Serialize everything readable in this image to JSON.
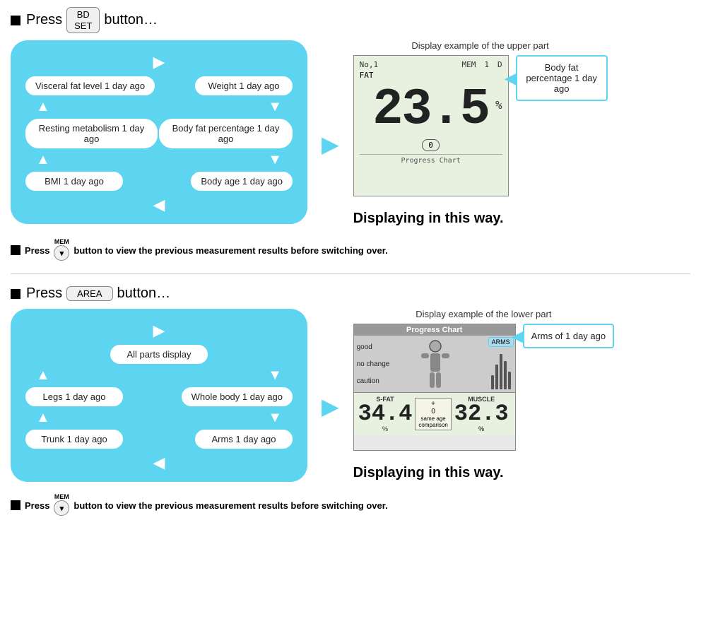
{
  "section1": {
    "header": "Press",
    "button_top": "BD",
    "button_bottom": "SET",
    "button_suffix": "button…",
    "display_label": "Display example of the upper part",
    "lcd": {
      "no": "No,1",
      "mem": "MEM",
      "one": "1",
      "d": "D",
      "fat": "FAT",
      "big_number": "23.5",
      "percent": "%",
      "zero": "0",
      "progress_chart": "Progress Chart"
    },
    "callout": "Body fat percentage 1 day ago",
    "items_left": [
      "Visceral fat level 1 day ago",
      "Resting metabolism 1 day ago",
      "BMI 1 day ago"
    ],
    "items_right": [
      "Weight 1 day ago",
      "Body fat percentage 1 day ago",
      "Body age 1 day ago"
    ],
    "displaying": "Displaying in this way.",
    "note": "Press",
    "mem_label": "MEM",
    "mem_arrow": "▾",
    "note_suffix": "button to view the previous measurement results before switching over."
  },
  "section2": {
    "header": "Press",
    "button_label": "AREA",
    "button_suffix": "button…",
    "display_label": "Display example of the lower part",
    "lcd": {
      "progress_chart": "Progress Chart",
      "arms_badge": "ARMS",
      "label_good": "good",
      "label_nochange": "no change",
      "label_caution": "caution",
      "sfat_label": "S-FAT",
      "sfat_num": "34.4",
      "sfat_pct": "%",
      "plus": "+",
      "zero": "0",
      "same_age": "same age",
      "comparison": "comparison",
      "muscle_label": "MUSCLE",
      "muscle_num": "32.3",
      "muscle_pct": "%"
    },
    "callout": "Arms of 1 day ago",
    "items_center_top": "All parts display",
    "items_left": [
      "Legs 1 day ago",
      "Trunk 1 day ago"
    ],
    "items_right": [
      "Whole body 1 day ago",
      "Arms 1 day ago"
    ],
    "displaying": "Displaying in this way.",
    "note": "Press",
    "mem_label": "MEM",
    "mem_arrow": "▾",
    "note_suffix": "button to view the previous measurement results before switching over."
  }
}
